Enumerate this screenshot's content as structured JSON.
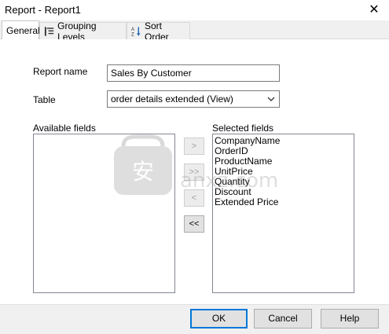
{
  "window": {
    "title": "Report - Report1"
  },
  "tabs": [
    {
      "label": "General",
      "icon": "none"
    },
    {
      "label": "Grouping Levels",
      "icon": "grouping-levels-icon"
    },
    {
      "label": "Sort Order",
      "icon": "sort-az-icon"
    }
  ],
  "general": {
    "report_name_label": "Report name",
    "report_name_value": "Sales By Customer",
    "table_label": "Table",
    "table_value": "order details extended (View)",
    "available_label": "Available fields",
    "selected_label": "Selected fields",
    "selected_fields": [
      "CompanyName",
      "OrderID",
      "ProductName",
      "UnitPrice",
      "Quantity",
      "Discount",
      "Extended Price"
    ],
    "movers": [
      ">",
      ">>",
      "<",
      "<<"
    ]
  },
  "footer": {
    "ok": "OK",
    "cancel": "Cancel",
    "help": "Help"
  },
  "watermark": {
    "text": "anxz.com",
    "glyph": "安"
  }
}
